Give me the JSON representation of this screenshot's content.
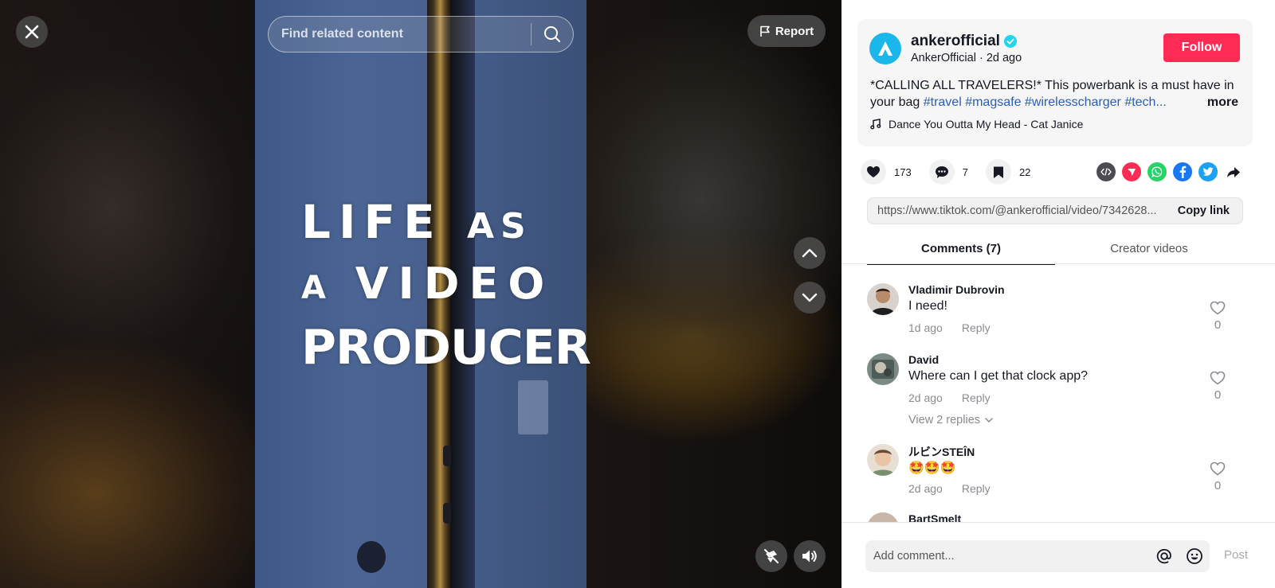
{
  "video": {
    "overlay_line1_big": "LIFE",
    "overlay_line1_small": "AS",
    "overlay_line2_small": "A",
    "overlay_line2_big": "VIDEO",
    "overlay_line3": "PRODUCER"
  },
  "topbar": {
    "search_placeholder": "Find related content",
    "report_label": "Report"
  },
  "creator": {
    "username": "ankerofficial",
    "display_name": "AnkerOfficial",
    "posted": "2d ago",
    "sub_separator": " · ",
    "follow_label": "Follow",
    "verified": true
  },
  "description": {
    "text": "*CALLING ALL TRAVELERS!* This powerbank is a must have in your bag",
    "tags": [
      "#travel",
      "#magsafe",
      "#wirelesscharger",
      "#tech..."
    ],
    "more_label": "more"
  },
  "music": {
    "title": "Dance You Outta My Head - Cat Janice"
  },
  "stats": {
    "likes": "173",
    "comments": "7",
    "saves": "22"
  },
  "share_icons": [
    "embed-icon",
    "tiktok-send-icon",
    "whatsapp-icon",
    "facebook-icon",
    "twitter-icon",
    "share-arrow-icon"
  ],
  "colors": {
    "accent": "#fe2c55",
    "verified": "#20d5ec",
    "hashtag": "#2b5db9",
    "anker": "#1bb7ec"
  },
  "link": {
    "url": "https://www.tiktok.com/@ankerofficial/video/7342628...",
    "copy_label": "Copy link"
  },
  "tabs": [
    {
      "label": "Comments (7)",
      "active": true
    },
    {
      "label": "Creator videos",
      "active": false
    }
  ],
  "comments": [
    {
      "name": "Vladimir Dubrovin",
      "text": "I need!",
      "time": "1d ago",
      "reply_label": "Reply",
      "likes": "0"
    },
    {
      "name": "David",
      "text": "Where can I get that clock app?",
      "time": "2d ago",
      "reply_label": "Reply",
      "likes": "0",
      "view_replies": "View 2 replies"
    },
    {
      "name": "ルビンSTEÎN",
      "text": "🤩🤩🤩",
      "time": "2d ago",
      "reply_label": "Reply",
      "likes": "0"
    },
    {
      "name": "BartSmelt"
    }
  ],
  "composer": {
    "placeholder": "Add comment...",
    "post_label": "Post"
  }
}
